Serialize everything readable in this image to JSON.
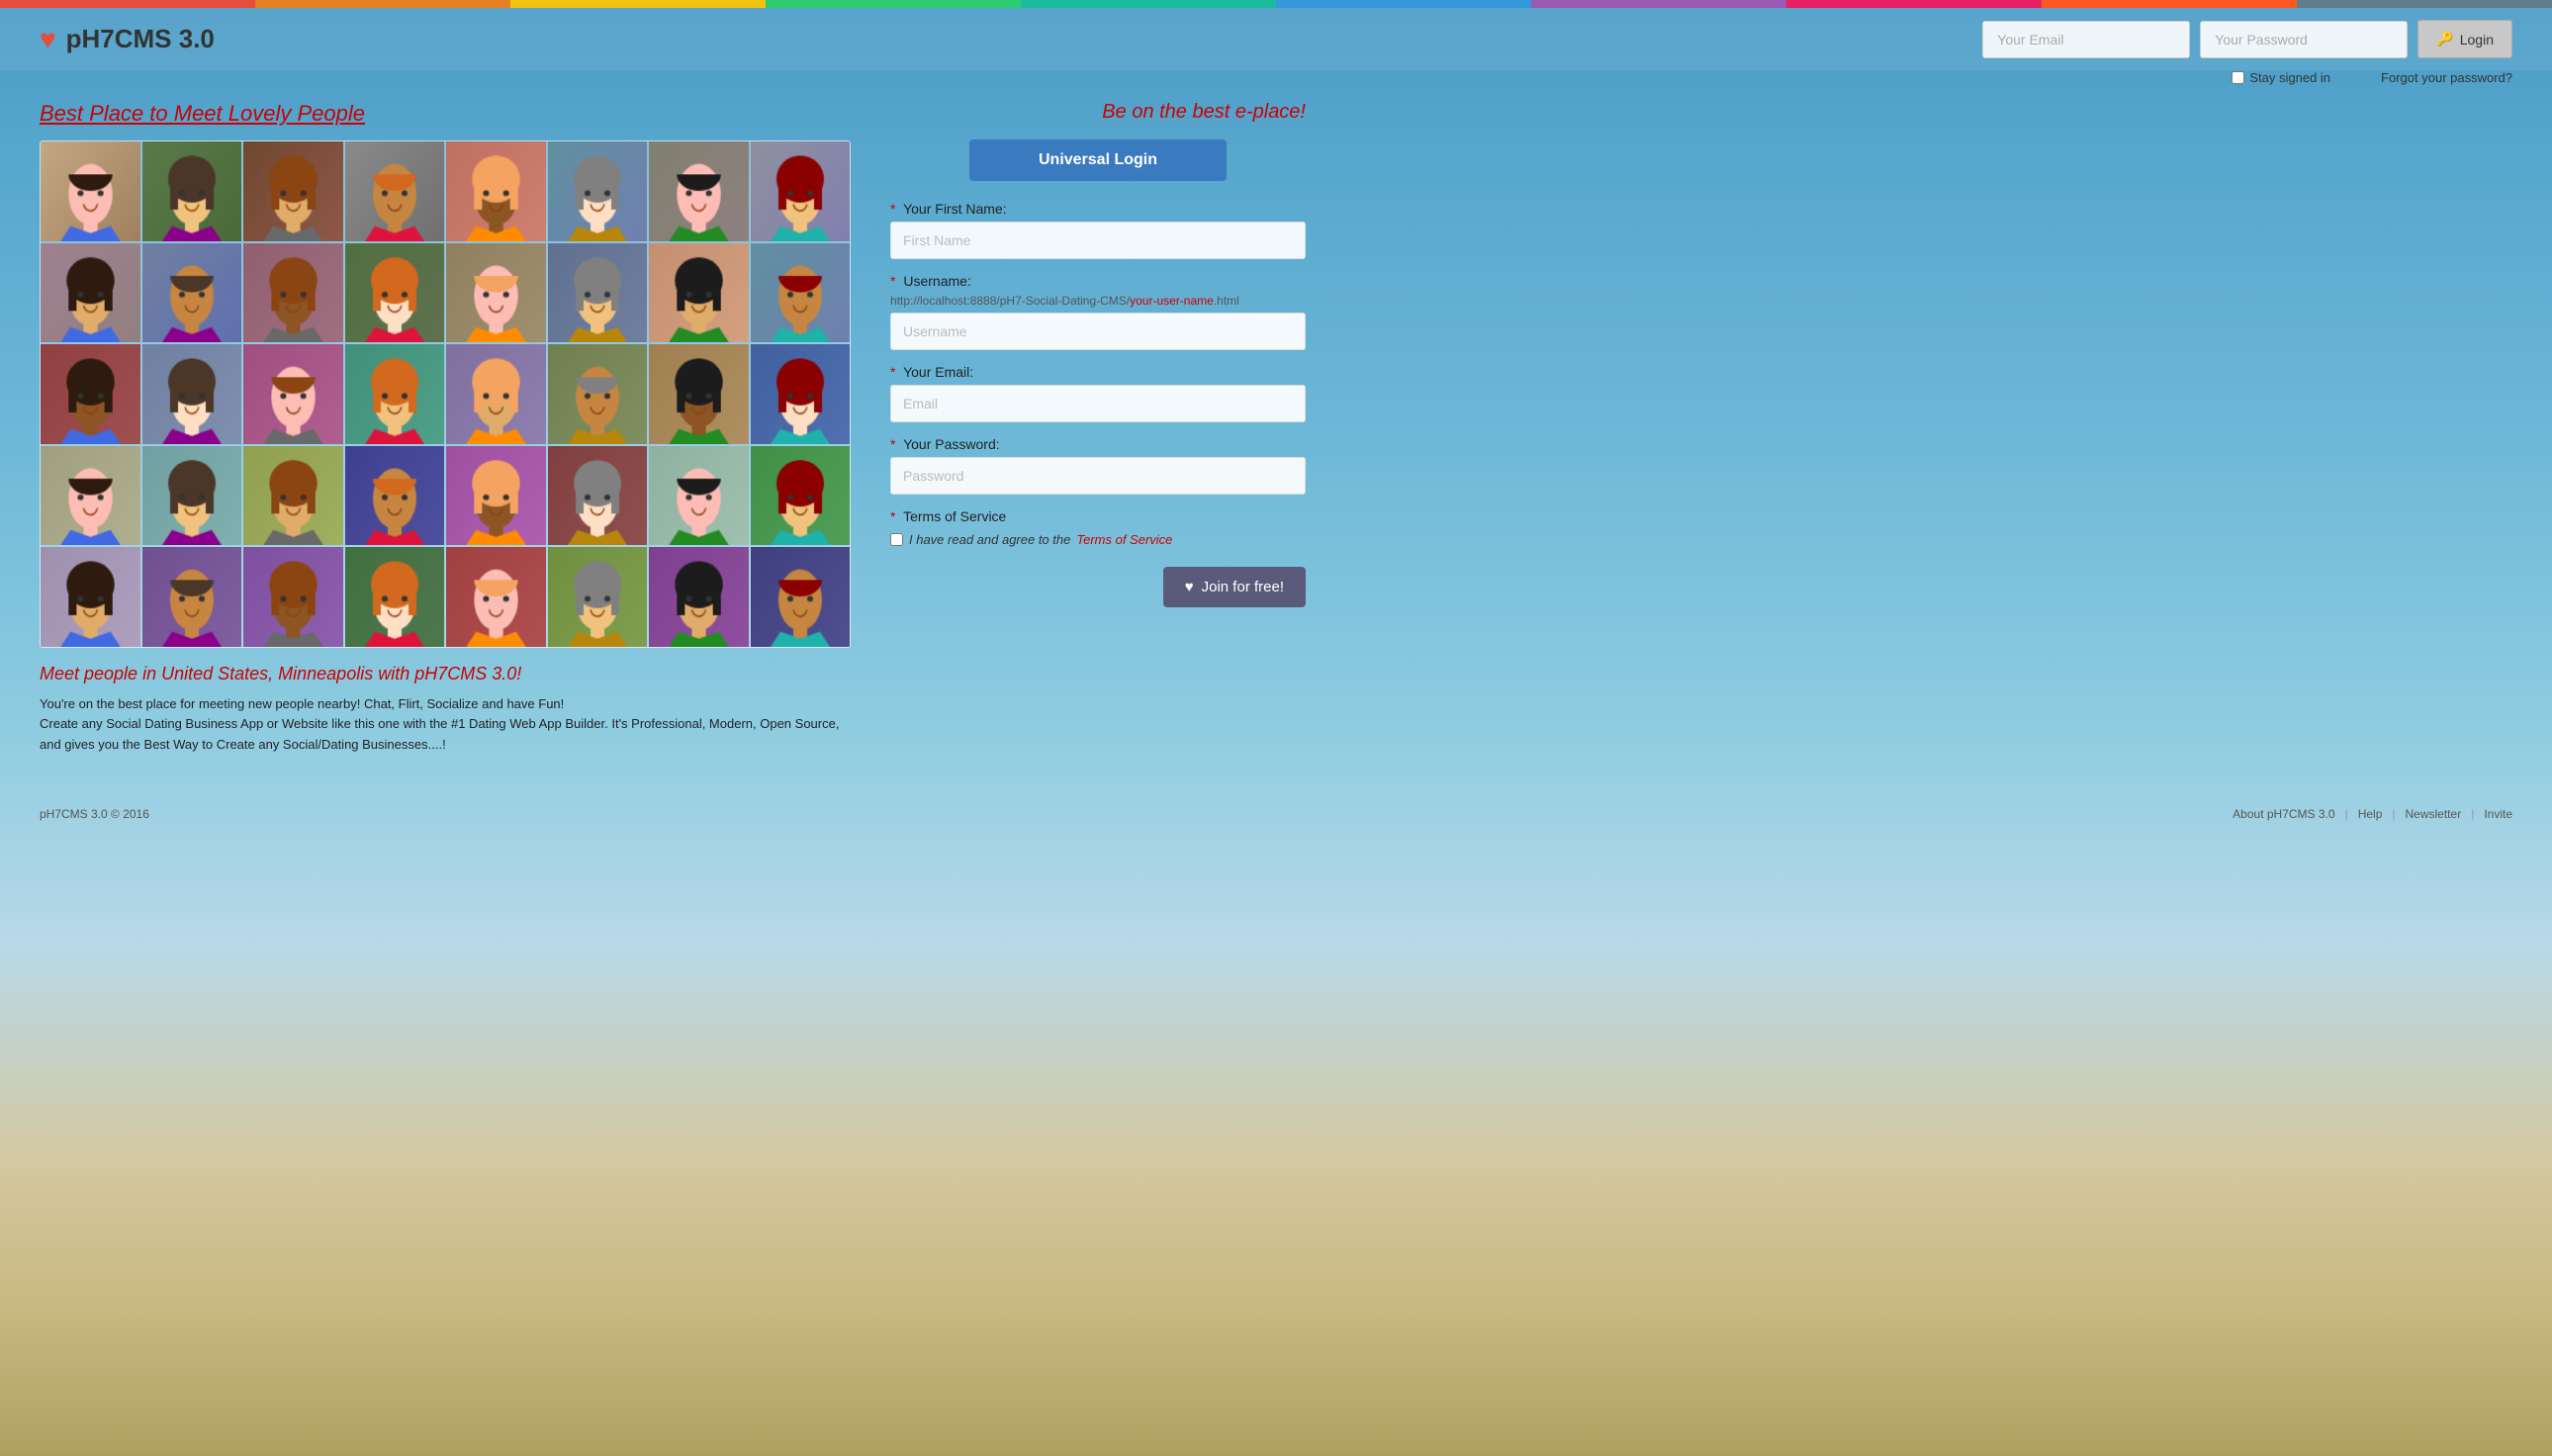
{
  "rainbow_bar": {},
  "header": {
    "logo_icon": "♥",
    "logo_text": "pH7CMS 3.0",
    "email_placeholder": "Your Email",
    "password_placeholder": "Your Password",
    "login_label": "Login",
    "stay_signed_label": "Stay signed in",
    "forgot_password_label": "Forgot your password?"
  },
  "left": {
    "tagline": "Best Place to Meet Lovely People",
    "meet_title": "Meet people in United States, Minneapolis with pH7CMS 3.0!",
    "description_1": "You're on the best place for meeting new people nearby! Chat, Flirt, Socialize and have Fun!",
    "description_2": "Create any Social Dating Business App or Website like this one with the #1 Dating Web App Builder. It's Professional, Modern, Open Source, and gives you the Best Way to Create any Social/Dating Businesses....!"
  },
  "right": {
    "be_best_label": "Be on the best e-place!",
    "universal_login_label": "Universal Login",
    "form": {
      "first_name_label": "Your First Name:",
      "first_name_placeholder": "First Name",
      "username_label": "Username:",
      "url_prefix": "http://localhost:8888/pH7-Social-Dating-CMS/",
      "url_variable": "your-user-name",
      "url_suffix": ".html",
      "username_placeholder": "Username",
      "email_label": "Your Email:",
      "email_placeholder": "Email",
      "password_label": "Your Password:",
      "password_placeholder": "Password",
      "tos_label": "Terms of Service",
      "tos_check_text": "I have read and agree to the",
      "tos_link_text": "Terms of Service",
      "required_mark": "*"
    },
    "join_button": "Join for free!",
    "join_icon": "♥"
  },
  "footer": {
    "copyright": "pH7CMS 3.0 © 2016",
    "links": [
      "About pH7CMS 3.0",
      "Help",
      "Newsletter",
      "Invite"
    ]
  },
  "avatars": [
    {
      "color1": "#8B7355",
      "color2": "#A0856E",
      "emoji": "👩"
    },
    {
      "color1": "#5C8A5C",
      "color2": "#4A7A4A",
      "emoji": "👩"
    },
    {
      "color1": "#6B5B45",
      "color2": "#8B7355",
      "emoji": "👨"
    },
    {
      "color1": "#888",
      "color2": "#aaa",
      "emoji": "👨"
    },
    {
      "color1": "#C47B6B",
      "color2": "#D4897A",
      "emoji": "👩"
    },
    {
      "color1": "#6B8B9B",
      "color2": "#7B9BAB",
      "emoji": "👩"
    },
    {
      "color1": "#8B7B6B",
      "color2": "#9B8B7B",
      "emoji": "👨"
    },
    {
      "color1": "#7B8B9B",
      "color2": "#8B9BAB",
      "emoji": "👩"
    },
    {
      "color1": "#9B7B8B",
      "color2": "#AB8B9B",
      "emoji": "👩"
    },
    {
      "color1": "#6B7B8B",
      "color2": "#7B8B9B",
      "emoji": "👩"
    },
    {
      "color1": "#8B6B7B",
      "color2": "#9B7B8B",
      "emoji": "👨"
    },
    {
      "color1": "#7B9B7B",
      "color2": "#8BAB8B",
      "emoji": "👨"
    },
    {
      "color1": "#8B8B6B",
      "color2": "#9B9B7B",
      "emoji": "👨"
    },
    {
      "color1": "#7B6B8B",
      "color2": "#8B7B9B",
      "emoji": "👩"
    },
    {
      "color1": "#9B8B6B",
      "color2": "#AB9B7B",
      "emoji": "👩"
    },
    {
      "color1": "#6B8B7B",
      "color2": "#7B9B8B",
      "emoji": "👩"
    },
    {
      "color1": "#8B6B6B",
      "color2": "#9B7B7B",
      "emoji": "👨"
    },
    {
      "color1": "#7B7B8B",
      "color2": "#8B8B9B",
      "emoji": "👩"
    },
    {
      "color1": "#9B6B7B",
      "color2": "#AB7B8B",
      "emoji": "👩"
    },
    {
      "color1": "#6B9B8B",
      "color2": "#7BAB9B",
      "emoji": "👩"
    },
    {
      "color1": "#8B7B9B",
      "color2": "#9B8BAB",
      "emoji": "👩"
    },
    {
      "color1": "#7B8B6B",
      "color2": "#8B9B7B",
      "emoji": "👨"
    },
    {
      "color1": "#9B7B6B",
      "color2": "#AB8B7B",
      "emoji": "👨"
    },
    {
      "color1": "#6B7B9B",
      "color2": "#7B8BAB",
      "emoji": "👨"
    },
    {
      "color1": "#9B9B8B",
      "color2": "#ABAB9B",
      "emoji": "👨"
    },
    {
      "color1": "#7B9B9B",
      "color2": "#8BABAB",
      "emoji": "👩"
    },
    {
      "color1": "#8B9B6B",
      "color2": "#9BAB7B",
      "emoji": "👨"
    },
    {
      "color1": "#6B6B9B",
      "color2": "#7B7BAB",
      "emoji": "👩"
    },
    {
      "color1": "#9B6B9B",
      "color2": "#AB7BAB",
      "emoji": "👩"
    },
    {
      "color1": "#7B6B6B",
      "color2": "#8B7B7B",
      "emoji": "👩"
    },
    {
      "color1": "#8B9B9B",
      "color2": "#9BABAB",
      "emoji": "👨"
    },
    {
      "color1": "#6B9B6B",
      "color2": "#7BAB7B",
      "emoji": "👨"
    },
    {
      "color1": "#9B8B9B",
      "color2": "#AB9BAB",
      "emoji": "👩"
    },
    {
      "color1": "#7B6B9B",
      "color2": "#8B7BAB",
      "emoji": "👩"
    },
    {
      "color1": "#8B6B9B",
      "color2": "#9B7BAB",
      "emoji": "👨"
    },
    {
      "color1": "#6B8B6B",
      "color2": "#7B9B7B",
      "emoji": "👩"
    },
    {
      "color1": "#9B6B6B",
      "color2": "#AB7B7B",
      "emoji": "👨"
    },
    {
      "color1": "#7B9B6B",
      "color2": "#8BAB7B",
      "emoji": "👩"
    },
    {
      "color1": "#8B6B8B",
      "color2": "#9B7B9B",
      "emoji": "👩"
    },
    {
      "color1": "#6B6B8B",
      "color2": "#7B7B9B",
      "emoji": "👨"
    }
  ]
}
